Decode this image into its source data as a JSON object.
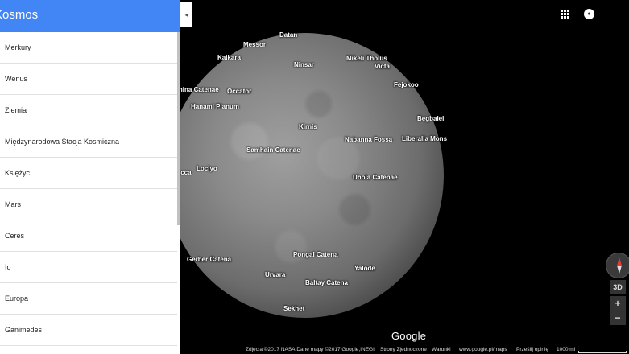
{
  "panel": {
    "title": "Kosmos",
    "collapse_icon": "◂",
    "items": [
      {
        "label": "Merkury"
      },
      {
        "label": "Wenus"
      },
      {
        "label": "Ziemia"
      },
      {
        "label": "Międzynarodowa Stacja Kosmiczna"
      },
      {
        "label": "Księżyc"
      },
      {
        "label": "Mars"
      },
      {
        "label": "Ceres"
      },
      {
        "label": "Io"
      },
      {
        "label": "Europa"
      },
      {
        "label": "Ganimedes"
      }
    ]
  },
  "features": [
    {
      "name": "Datan"
    },
    {
      "name": "Messor"
    },
    {
      "name": "Kaikara"
    },
    {
      "name": "Ninsar"
    },
    {
      "name": "Mikeli Tholus"
    },
    {
      "name": "Victa"
    },
    {
      "name": "Fejokoo"
    },
    {
      "name": "Samnina Catenae"
    },
    {
      "name": "Occator"
    },
    {
      "name": "Hanami Planum"
    },
    {
      "name": "Begbalel"
    },
    {
      "name": "Kirnis"
    },
    {
      "name": "Nabanna Fossa"
    },
    {
      "name": "Liberalia Mons"
    },
    {
      "name": "Samhain Catenae"
    },
    {
      "name": "Lociyo"
    },
    {
      "name": "Geracca"
    },
    {
      "name": "Uhola Catenae"
    },
    {
      "name": "Gerber Catena"
    },
    {
      "name": "Pongal Catena"
    },
    {
      "name": "Yalode"
    },
    {
      "name": "Urvara"
    },
    {
      "name": "Baltay Catena"
    },
    {
      "name": "Sekhet"
    }
  ],
  "controls": {
    "account_icon": "account-circle-icon",
    "apps_icon": "apps-grid-icon",
    "compass_icon": "compass-icon",
    "btn_3d": "3D",
    "zoom_in": "+",
    "zoom_out": "−"
  },
  "brand": {
    "logo": "Google"
  },
  "footer": {
    "attribution": "Zdjęcia ©2017 NASA,Dane mapy ©2017 Google,INEGI",
    "site": "Strony Zjednoczone",
    "terms": "Warunki",
    "url": "www.google.pl/maps",
    "feedback": "Prześlij opinię",
    "scale": "1000 mi"
  },
  "colors": {
    "panel_header": "#4285f4",
    "background": "#000000",
    "planet": "#8a8a8a"
  }
}
